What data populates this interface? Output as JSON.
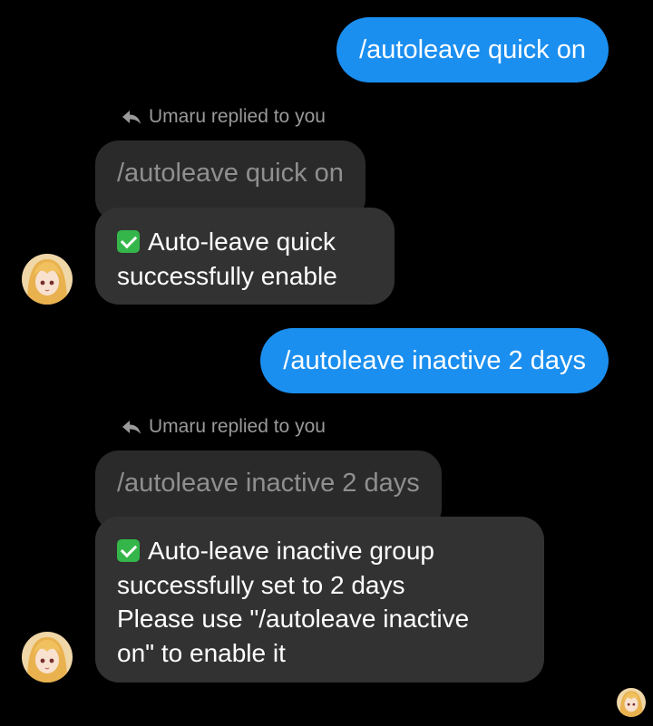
{
  "messages": [
    {
      "type": "outgoing",
      "text": "/autoleave quick on"
    },
    {
      "type": "incoming",
      "reply_label": "Umaru replied to you",
      "quoted": "/autoleave quick on",
      "lines": [
        "Auto-leave quick",
        "successfully enable"
      ]
    },
    {
      "type": "outgoing",
      "text": "/autoleave inactive 2 days"
    },
    {
      "type": "incoming",
      "reply_label": "Umaru replied to you",
      "quoted": "/autoleave inactive 2 days",
      "lines": [
        "Auto-leave inactive group",
        "successfully set to 2 days",
        "Please use \"/autoleave inactive",
        "on\" to enable it"
      ]
    }
  ],
  "icons": {
    "reply": "reply-arrow-icon",
    "check": "green-checkmark-icon",
    "avatar": "umaru-avatar",
    "read_receipt": "read-receipt-avatar"
  },
  "colors": {
    "background": "#000000",
    "outgoing_bubble": "#1b8ff0",
    "incoming_bubble": "#323232",
    "quoted_bubble": "#2a2a2a",
    "check_green": "#35b64a"
  }
}
